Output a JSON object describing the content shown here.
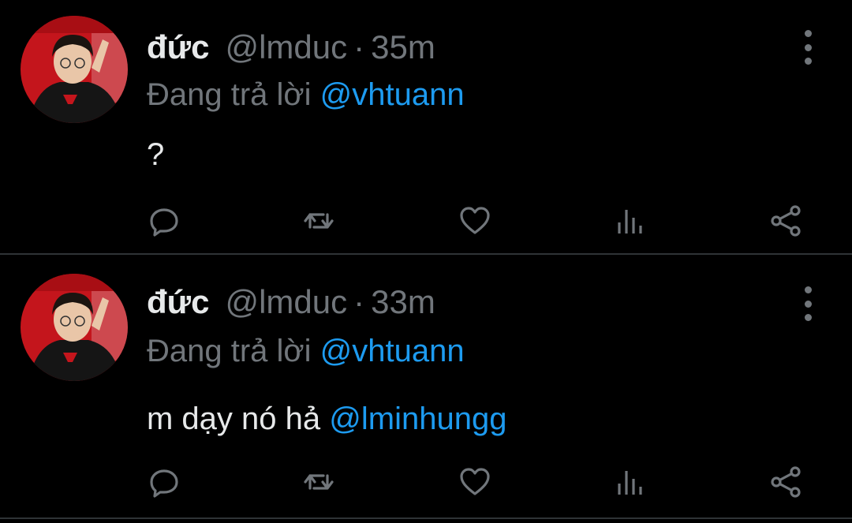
{
  "colors": {
    "background": "#000000",
    "primary_text": "#e7e9ea",
    "secondary_text": "#71767b",
    "link": "#1d9bf0",
    "divider": "#2f3336"
  },
  "tweets": [
    {
      "author_name": "đức",
      "author_handle": "@lmduc",
      "separator": "·",
      "time": "35m",
      "reply_prefix": "Đang trả lời",
      "reply_to": "@vhtuann",
      "text": "?",
      "text_mention": "",
      "icons": [
        "reply-icon",
        "retweet-icon",
        "like-icon",
        "views-icon",
        "share-icon",
        "more-icon"
      ]
    },
    {
      "author_name": "đức",
      "author_handle": "@lmduc",
      "separator": "·",
      "time": "33m",
      "reply_prefix": "Đang trả lời",
      "reply_to": "@vhtuann",
      "text": "m dạy nó hả",
      "text_mention": "@lminhungg",
      "icons": [
        "reply-icon",
        "retweet-icon",
        "like-icon",
        "views-icon",
        "share-icon",
        "more-icon"
      ]
    }
  ]
}
